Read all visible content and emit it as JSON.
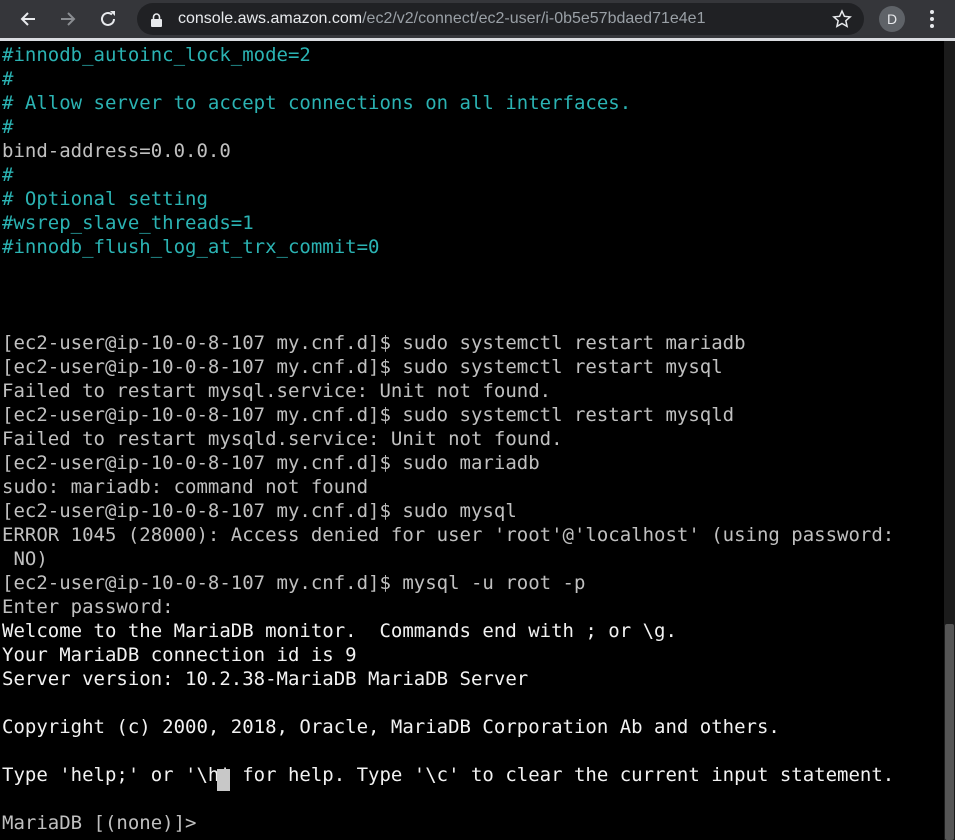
{
  "browser": {
    "url_host": "console.aws.amazon.com",
    "url_path": "/ec2/v2/connect/ec2-user/i-0b5e57bdaed71e4e1",
    "avatar_initial": "D",
    "icons": [
      "back-arrow-icon",
      "forward-arrow-icon",
      "reload-icon",
      "lock-icon",
      "star-icon",
      "kebab-menu-icon"
    ]
  },
  "terminal": {
    "lines": [
      {
        "text": "#innodb_autoinc_lock_mode=2",
        "style": "cmt"
      },
      {
        "text": "#",
        "style": "cmt"
      },
      {
        "text": "# Allow server to accept connections on all interfaces.",
        "style": "cmt"
      },
      {
        "text": "#",
        "style": "cmt"
      },
      {
        "text": "bind-address=0.0.0.0",
        "style": "normal"
      },
      {
        "text": "#",
        "style": "cmt"
      },
      {
        "text": "# Optional setting",
        "style": "cmt"
      },
      {
        "text": "#wsrep_slave_threads=1",
        "style": "cmt"
      },
      {
        "text": "#innodb_flush_log_at_trx_commit=0",
        "style": "cmt"
      },
      {
        "text": "",
        "style": "normal"
      },
      {
        "text": "",
        "style": "normal"
      },
      {
        "text": "",
        "style": "normal"
      },
      {
        "text": "[ec2-user@ip-10-0-8-107 my.cnf.d]$ sudo systemctl restart mariadb",
        "style": "normal"
      },
      {
        "text": "[ec2-user@ip-10-0-8-107 my.cnf.d]$ sudo systemctl restart mysql",
        "style": "normal"
      },
      {
        "text": "Failed to restart mysql.service: Unit not found.",
        "style": "normal"
      },
      {
        "text": "[ec2-user@ip-10-0-8-107 my.cnf.d]$ sudo systemctl restart mysqld",
        "style": "normal"
      },
      {
        "text": "Failed to restart mysqld.service: Unit not found.",
        "style": "normal"
      },
      {
        "text": "[ec2-user@ip-10-0-8-107 my.cnf.d]$ sudo mariadb",
        "style": "normal"
      },
      {
        "text": "sudo: mariadb: command not found",
        "style": "normal"
      },
      {
        "text": "[ec2-user@ip-10-0-8-107 my.cnf.d]$ sudo mysql",
        "style": "normal"
      },
      {
        "text": "ERROR 1045 (28000): Access denied for user 'root'@'localhost' (using password:",
        "style": "normal"
      },
      {
        "text": " NO)",
        "style": "normal"
      },
      {
        "text": "[ec2-user@ip-10-0-8-107 my.cnf.d]$ mysql -u root -p",
        "style": "normal"
      },
      {
        "text": "Enter password:",
        "style": "normal"
      },
      {
        "text": "Welcome to the MariaDB monitor.  Commands end with ; or \\g.",
        "style": "bright"
      },
      {
        "text": "Your MariaDB connection id is 9",
        "style": "bright"
      },
      {
        "text": "Server version: 10.2.38-MariaDB MariaDB Server",
        "style": "bright"
      },
      {
        "text": "",
        "style": "normal"
      },
      {
        "text": "Copyright (c) 2000, 2018, Oracle, MariaDB Corporation Ab and others.",
        "style": "bright"
      },
      {
        "text": "",
        "style": "normal"
      },
      {
        "text": "Type 'help;' or '\\h' for help. Type '\\c' to clear the current input statement.",
        "style": "bright"
      },
      {
        "text": "",
        "style": "normal"
      },
      {
        "text": "MariaDB [(none)]> ",
        "style": "normal"
      }
    ]
  }
}
